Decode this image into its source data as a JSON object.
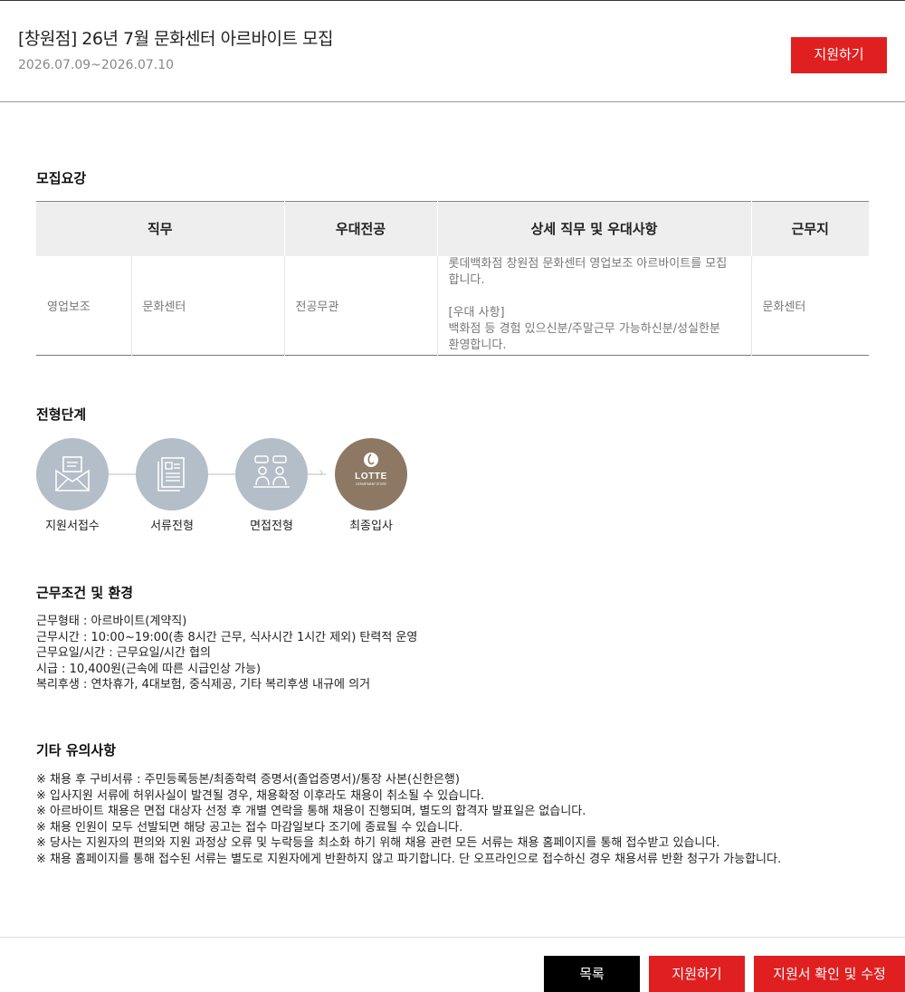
{
  "header": {
    "title": "[창원점] 26년 7월 문화센터 아르바이트 모집",
    "period": "2026.07.09~2026.07.10",
    "apply_label": "지원하기"
  },
  "recruit": {
    "section_title": "모집요강",
    "columns": [
      "직무",
      "우대전공",
      "상세 직무 및 우대사항",
      "근무지"
    ],
    "row": {
      "job": "영업보조",
      "dept": "문화센터",
      "major": "전공무관",
      "detail_lines": [
        "롯데백화점 창원점 문화센터 영업보조 아르바이트를 모집",
        "합니다.",
        "",
        "[우대 사항]",
        "백화점 등 경험 있으신분/주말근무 가능하신분/성실한분",
        "환영합니다."
      ],
      "location": "문화센터"
    }
  },
  "process": {
    "section_title": "전형단계",
    "steps": [
      {
        "label": "지원서접수",
        "icon": "envelope-icon"
      },
      {
        "label": "서류전형",
        "icon": "document-icon"
      },
      {
        "label": "면접전형",
        "icon": "interview-icon"
      },
      {
        "label": "최종입사",
        "icon": "lotte-logo"
      }
    ],
    "logo_text": "LOTTE",
    "logo_subtext": "DEPARTMENT STORE"
  },
  "conditions": {
    "section_title": "근무조건 및 환경",
    "lines": [
      "근무형태 : 아르바이트(계약직)",
      "근무시간 : 10:00~19:00(총 8시간 근무, 식사시간 1시간 제외) 탄력적 운영",
      "근무요일/시간 : 근무요일/시간 협의",
      "시급 : 10,400원(근속에 따른 시급인상 가능)",
      "복리후생 : 연차휴가, 4대보험, 중식제공, 기타 복리후생 내규에 의거"
    ]
  },
  "notes": {
    "section_title": "기타 유의사항",
    "lines": [
      "※ 채용 후 구비서류 : 주민등록등본/최종학력 증명서(졸업증명서)/통장 사본(신한은행)",
      "※ 입사지원 서류에 허위사실이 발견될 경우, 채용확정 이후라도 채용이 취소될 수 있습니다.",
      "※ 아르바이트 채용은 면접 대상자 선정 후 개별 연락을 통해 채용이 진행되며, 별도의 합격자 발표일은 없습니다.",
      "※ 채용 인원이 모두 선발되면 해당 공고는 접수 마감일보다 조기에 종료될 수 있습니다.",
      "※ 당사는 지원자의 편의와 지원 과정상 오류 및 누락등을 최소화 하기 위해 채용 관련 모든 서류는 채용 홈페이지를 통해 접수받고 있습니다.",
      "※ 채용 홈페이지를 통해 접수된 서류는 별도로 지원자에게 반환하지 않고 파기합니다. 단 오프라인으로 접수하신 경우 채용서류 반환 청구가 가능합니다."
    ]
  },
  "footer": {
    "list_label": "목록",
    "apply_label": "지원하기",
    "edit_label": "지원서 확인 및 수정"
  },
  "colors": {
    "accent": "#e02020",
    "step_circle": "#b3bec8",
    "final_circle": "#8d7963"
  }
}
